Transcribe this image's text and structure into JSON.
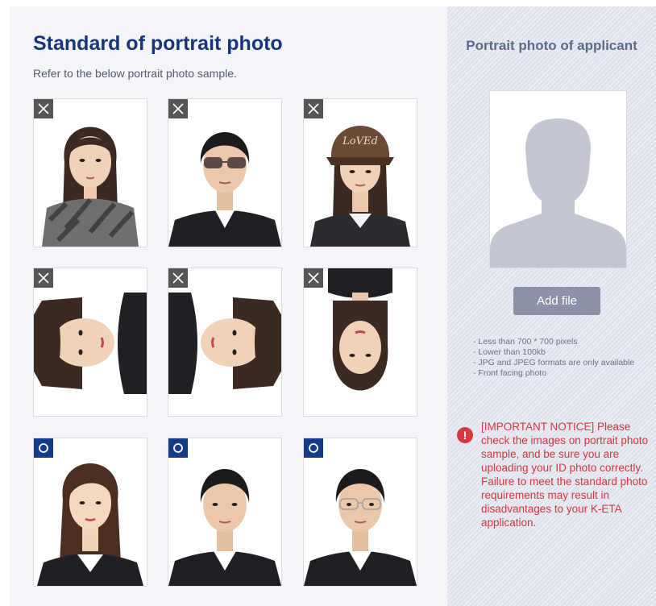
{
  "standard": {
    "title": "Standard of portrait photo",
    "subtitle": "Refer to the below portrait photo sample.",
    "samples": [
      {
        "status": "x",
        "issue": "scarf covering neck"
      },
      {
        "status": "x",
        "issue": "sunglasses"
      },
      {
        "status": "x",
        "issue": "cap"
      },
      {
        "status": "x",
        "issue": "rotated 90 degrees right"
      },
      {
        "status": "x",
        "issue": "rotated 90 degrees left"
      },
      {
        "status": "x",
        "issue": "upside down"
      },
      {
        "status": "o",
        "issue": "correct female"
      },
      {
        "status": "o",
        "issue": "correct male"
      },
      {
        "status": "o",
        "issue": "correct male with glasses"
      }
    ]
  },
  "applicant": {
    "title": "Portrait photo of applicant",
    "add_file_label": "Add file",
    "requirements": [
      "- Less than 700 * 700 pixels",
      "- Lower than 100kb",
      "- JPG and JPEG formats are only available",
      "- Front facing photo"
    ],
    "notice_icon": "!",
    "notice_text": "[IMPORTANT NOTICE] Please check the images on portrait photo sample, and be sure you are uploading your ID photo correctly. Failure to meet the standard photo requirements may result in disadvantages to your K-ETA application."
  },
  "colors": {
    "title": "#17357a",
    "x_mark": "#555555",
    "o_mark": "#163a8a",
    "notice": "#d2363e",
    "button": "#8d91a7"
  }
}
